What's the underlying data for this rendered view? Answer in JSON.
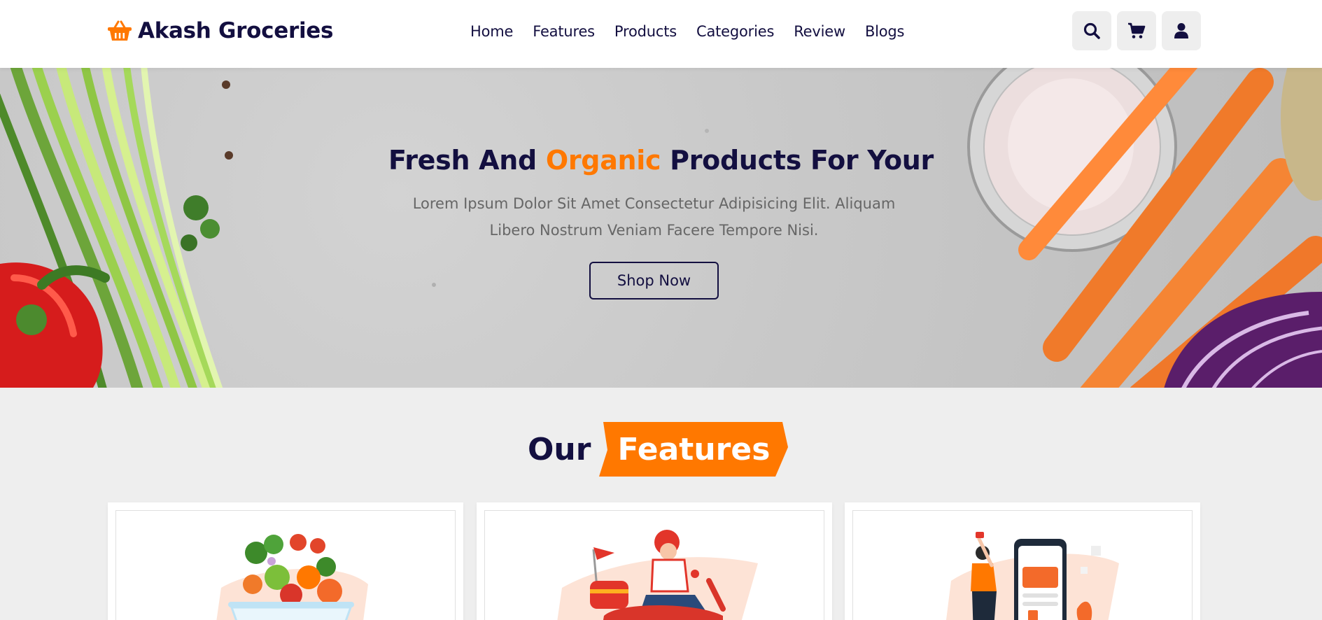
{
  "brand": {
    "name": "Akash Groceries",
    "icon": "basket-icon",
    "accent": "#ff7800",
    "dark": "#130f40"
  },
  "nav": [
    {
      "label": "Home"
    },
    {
      "label": "Features"
    },
    {
      "label": "Products"
    },
    {
      "label": "Categories"
    },
    {
      "label": "Review"
    },
    {
      "label": "Blogs"
    }
  ],
  "header_icons": [
    "search-icon",
    "cart-icon",
    "user-icon"
  ],
  "hero": {
    "title_before": "Fresh And ",
    "title_accent": "Organic",
    "title_after": " Products For Your",
    "description": "Lorem Ipsum Dolor Sit Amet Consectetur Adipisicing Elit. Aliquam Libero Nostrum Veniam Facere Tempore Nisi.",
    "button": "Shop Now"
  },
  "features": {
    "heading_plain": "Our",
    "heading_accent": "Features",
    "cards": [
      {
        "image": "vegetable-basket-illustration"
      },
      {
        "image": "delivery-scooter-illustration"
      },
      {
        "image": "mobile-payment-illustration"
      }
    ]
  }
}
